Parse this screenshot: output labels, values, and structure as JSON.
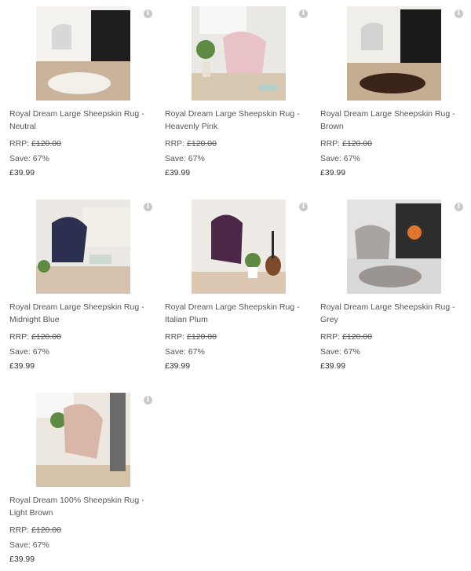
{
  "products": [
    {
      "title_line1": "Royal Dream Large Sheepskin Rug -",
      "title_line2": "Neutral",
      "rrp_label": "RRP:",
      "rrp_value": "£120.00",
      "save_text": "Save: 67%",
      "price": "£39.99",
      "image_icon": "product-photo",
      "rug_color": "#f3f0ea"
    },
    {
      "title_line1": "Royal Dream Large Sheepskin Rug -",
      "title_line2": "Heavenly Pink",
      "rrp_label": "RRP:",
      "rrp_value": "£120.00",
      "save_text": "Save: 67%",
      "price": "£39.99",
      "image_icon": "product-photo",
      "rug_color": "#e8c2c6"
    },
    {
      "title_line1": "Royal Dream Large Sheepskin Rug -",
      "title_line2": "Brown",
      "rrp_label": "RRP:",
      "rrp_value": "£120.00",
      "save_text": "Save: 67%",
      "price": "£39.99",
      "image_icon": "product-photo",
      "rug_color": "#3a2318"
    },
    {
      "title_line1": "Royal Dream Large Sheepskin Rug -",
      "title_line2": "Midnight Blue",
      "rrp_label": "RRP:",
      "rrp_value": "£120.00",
      "save_text": "Save: 67%",
      "price": "£39.99",
      "image_icon": "product-photo",
      "rug_color": "#2c3050"
    },
    {
      "title_line1": "Royal Dream Large Sheepskin Rug -",
      "title_line2": "Italian Plum",
      "rrp_label": "RRP:",
      "rrp_value": "£120.00",
      "save_text": "Save: 67%",
      "price": "£39.99",
      "image_icon": "product-photo",
      "rug_color": "#4d2748"
    },
    {
      "title_line1": "Royal Dream Large Sheepskin Rug -",
      "title_line2": "Grey",
      "rrp_label": "RRP:",
      "rrp_value": "£120.00",
      "save_text": "Save: 67%",
      "price": "£39.99",
      "image_icon": "product-photo",
      "rug_color": "#9a9593"
    },
    {
      "title_line1": "Royal Dream 100% Sheepskin Rug -",
      "title_line2": "Light Brown",
      "rrp_label": "RRP:",
      "rrp_value": "£120.00",
      "save_text": "Save: 67%",
      "price": "£39.99",
      "image_icon": "product-photo",
      "rug_color": "#d8b7a8"
    }
  ],
  "info_icon": "info-icon",
  "colors": {
    "text": "#555555",
    "price": "#333333",
    "info_icon_bg": "#c9c9c9"
  }
}
